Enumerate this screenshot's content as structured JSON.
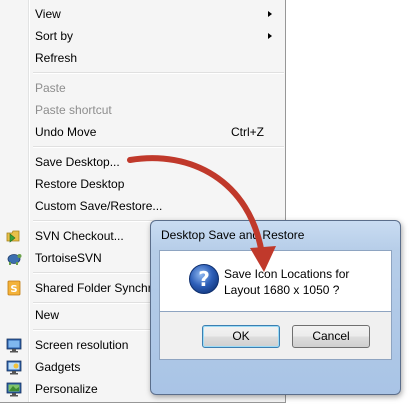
{
  "context_menu": {
    "items": [
      {
        "label": "View"
      },
      {
        "label": "Sort by"
      },
      {
        "label": "Refresh"
      },
      {
        "label": "Paste"
      },
      {
        "label": "Paste shortcut"
      },
      {
        "label": "Undo Move",
        "shortcut": "Ctrl+Z"
      },
      {
        "label": "Save Desktop..."
      },
      {
        "label": "Restore Desktop"
      },
      {
        "label": "Custom Save/Restore..."
      },
      {
        "label": "SVN Checkout..."
      },
      {
        "label": "TortoiseSVN"
      },
      {
        "label": "Shared Folder Synchronization"
      },
      {
        "label": "New"
      },
      {
        "label": "Screen resolution"
      },
      {
        "label": "Gadgets"
      },
      {
        "label": "Personalize"
      }
    ]
  },
  "dialog": {
    "title": "Desktop Save and Restore",
    "message_line1": "Save Icon Locations for",
    "message_line2": "Layout 1680 x 1050 ?",
    "ok_label": "OK",
    "cancel_label": "Cancel",
    "icon": "question-icon"
  },
  "colors": {
    "annotation_arrow": "#c0392b",
    "dialog_frame": "#b6cde8"
  }
}
